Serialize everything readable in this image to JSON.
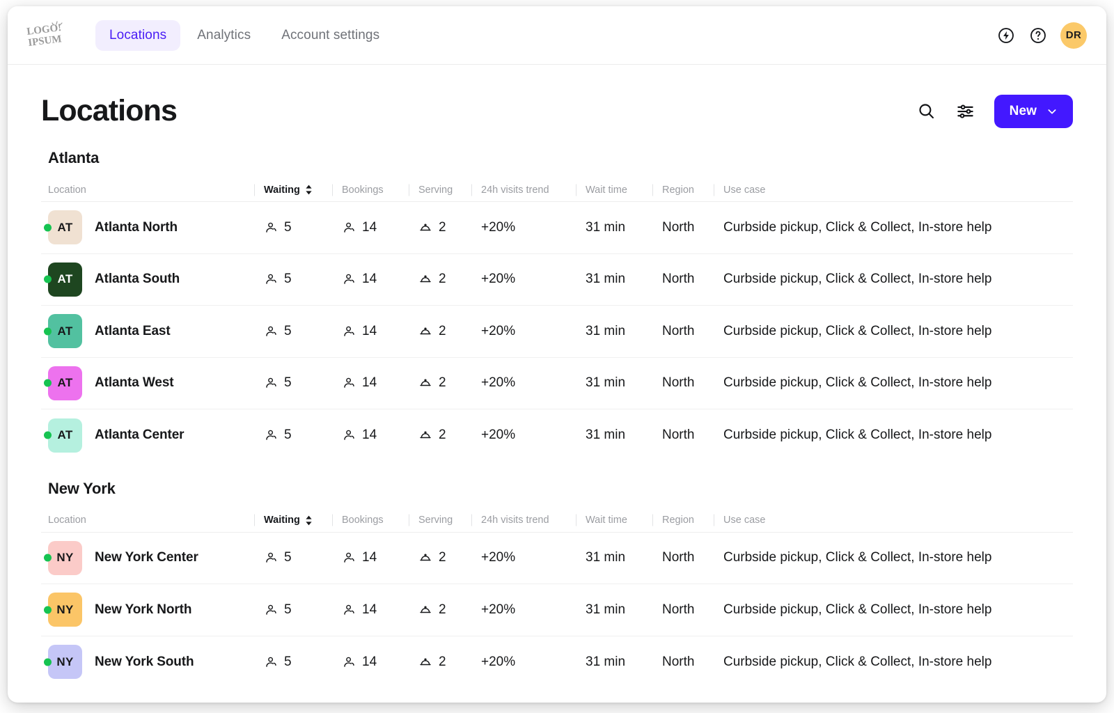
{
  "brand": {
    "logo_line1": "LOGO!",
    "logo_line2": "IPSUM"
  },
  "nav": {
    "tabs": [
      {
        "label": "Locations",
        "active": true
      },
      {
        "label": "Analytics",
        "active": false
      },
      {
        "label": "Account settings",
        "active": false
      }
    ],
    "icons": [
      {
        "name": "bolt-icon",
        "glyph": "bolt"
      },
      {
        "name": "help-icon",
        "glyph": "question"
      }
    ],
    "avatar_initials": "DR",
    "avatar_color": "#FBC969"
  },
  "header": {
    "title": "Locations",
    "search_icon": "search-icon",
    "filter_icon": "filter-sliders-icon",
    "new_button_label": "New",
    "new_button_color": "#4318FF"
  },
  "columns": [
    {
      "key": "location",
      "label": "Location",
      "sortable": false,
      "active": false
    },
    {
      "key": "waiting",
      "label": "Waiting",
      "sortable": true,
      "active": true
    },
    {
      "key": "bookings",
      "label": "Bookings",
      "sortable": false,
      "active": false
    },
    {
      "key": "serving",
      "label": "Serving",
      "sortable": false,
      "active": false
    },
    {
      "key": "trend",
      "label": "24h visits trend",
      "sortable": false,
      "active": false
    },
    {
      "key": "wait_time",
      "label": "Wait time",
      "sortable": false,
      "active": false
    },
    {
      "key": "region",
      "label": "Region",
      "sortable": false,
      "active": false
    },
    {
      "key": "use_case",
      "label": "Use case",
      "sortable": false,
      "active": false
    }
  ],
  "sections": [
    {
      "title": "Atlanta",
      "rows": [
        {
          "initials": "AT",
          "badge_color": "#F0E1D2",
          "badge_text_color": "#17181A",
          "status": "online",
          "name": "Atlanta North",
          "waiting": "5",
          "bookings": "14",
          "serving": "2",
          "trend": "+20%",
          "wait_time": "31 min",
          "region": "North",
          "use_case": "Curbside pickup, Click & Collect, In-store help"
        },
        {
          "initials": "AT",
          "badge_color": "#1E4620",
          "badge_text_color": "#FFFFFF",
          "status": "online",
          "name": "Atlanta South",
          "waiting": "5",
          "bookings": "14",
          "serving": "2",
          "trend": "+20%",
          "wait_time": "31 min",
          "region": "North",
          "use_case": "Curbside pickup, Click & Collect, In-store help"
        },
        {
          "initials": "AT",
          "badge_color": "#52C1A0",
          "badge_text_color": "#17181A",
          "status": "online",
          "name": "Atlanta East",
          "waiting": "5",
          "bookings": "14",
          "serving": "2",
          "trend": "+20%",
          "wait_time": "31 min",
          "region": "North",
          "use_case": "Curbside pickup, Click & Collect, In-store help"
        },
        {
          "initials": "AT",
          "badge_color": "#ED72EE",
          "badge_text_color": "#17181A",
          "status": "online",
          "name": "Atlanta West",
          "waiting": "5",
          "bookings": "14",
          "serving": "2",
          "trend": "+20%",
          "wait_time": "31 min",
          "region": "North",
          "use_case": "Curbside pickup, Click & Collect, In-store help"
        },
        {
          "initials": "AT",
          "badge_color": "#B5F0DF",
          "badge_text_color": "#17181A",
          "status": "online",
          "name": "Atlanta Center",
          "waiting": "5",
          "bookings": "14",
          "serving": "2",
          "trend": "+20%",
          "wait_time": "31 min",
          "region": "North",
          "use_case": "Curbside pickup, Click & Collect, In-store help"
        }
      ]
    },
    {
      "title": "New York",
      "rows": [
        {
          "initials": "NY",
          "badge_color": "#FBCBC8",
          "badge_text_color": "#17181A",
          "status": "online",
          "name": "New York Center",
          "waiting": "5",
          "bookings": "14",
          "serving": "2",
          "trend": "+20%",
          "wait_time": "31 min",
          "region": "North",
          "use_case": "Curbside pickup, Click & Collect, In-store help"
        },
        {
          "initials": "NY",
          "badge_color": "#FBC567",
          "badge_text_color": "#17181A",
          "status": "online",
          "name": "New York North",
          "waiting": "5",
          "bookings": "14",
          "serving": "2",
          "trend": "+20%",
          "wait_time": "31 min",
          "region": "North",
          "use_case": "Curbside pickup, Click & Collect, In-store help"
        },
        {
          "initials": "NY",
          "badge_color": "#C5C6F7",
          "badge_text_color": "#17181A",
          "status": "online",
          "name": "New York South",
          "waiting": "5",
          "bookings": "14",
          "serving": "2",
          "trend": "+20%",
          "wait_time": "31 min",
          "region": "North",
          "use_case": "Curbside pickup, Click & Collect, In-store help"
        }
      ]
    }
  ],
  "icons": {
    "waiting": "person-icon",
    "bookings": "person-icon",
    "serving": "cloche-icon"
  },
  "colors": {
    "accent": "#4318FF",
    "accent_soft": "#F2EEFE",
    "status_online": "#16C351"
  }
}
